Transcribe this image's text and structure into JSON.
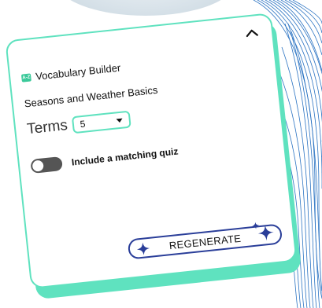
{
  "card": {
    "app_title": "Vocabulary Builder",
    "app_icon_text": "A-Z",
    "topic": "Seasons and Weather Basics",
    "terms_label": "Terms",
    "terms_value": "5",
    "quiz_label": "Include a matching quiz",
    "quiz_enabled": false,
    "regenerate_label": "REGENERATE"
  },
  "icons": {
    "collapse": "chevron-up-icon",
    "app": "vocabulary-icon",
    "dropdown": "caret-down-icon",
    "sparkle": "sparkle-icon"
  },
  "colors": {
    "accent": "#5fe2bf",
    "button_border": "#2a3e99",
    "toggle_off": "#555555"
  }
}
